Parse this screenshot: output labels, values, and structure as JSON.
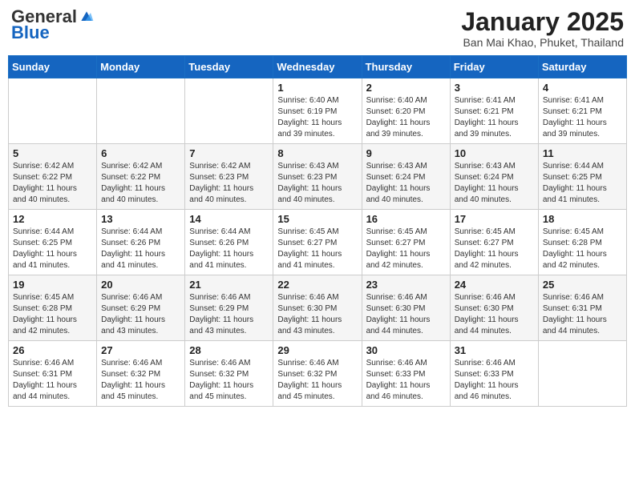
{
  "header": {
    "logo_general": "General",
    "logo_blue": "Blue",
    "month_title": "January 2025",
    "location": "Ban Mai Khao, Phuket, Thailand"
  },
  "days_of_week": [
    "Sunday",
    "Monday",
    "Tuesday",
    "Wednesday",
    "Thursday",
    "Friday",
    "Saturday"
  ],
  "weeks": [
    [
      {
        "day": "",
        "info": ""
      },
      {
        "day": "",
        "info": ""
      },
      {
        "day": "",
        "info": ""
      },
      {
        "day": "1",
        "info": "Sunrise: 6:40 AM\nSunset: 6:19 PM\nDaylight: 11 hours\nand 39 minutes."
      },
      {
        "day": "2",
        "info": "Sunrise: 6:40 AM\nSunset: 6:20 PM\nDaylight: 11 hours\nand 39 minutes."
      },
      {
        "day": "3",
        "info": "Sunrise: 6:41 AM\nSunset: 6:21 PM\nDaylight: 11 hours\nand 39 minutes."
      },
      {
        "day": "4",
        "info": "Sunrise: 6:41 AM\nSunset: 6:21 PM\nDaylight: 11 hours\nand 39 minutes."
      }
    ],
    [
      {
        "day": "5",
        "info": "Sunrise: 6:42 AM\nSunset: 6:22 PM\nDaylight: 11 hours\nand 40 minutes."
      },
      {
        "day": "6",
        "info": "Sunrise: 6:42 AM\nSunset: 6:22 PM\nDaylight: 11 hours\nand 40 minutes."
      },
      {
        "day": "7",
        "info": "Sunrise: 6:42 AM\nSunset: 6:23 PM\nDaylight: 11 hours\nand 40 minutes."
      },
      {
        "day": "8",
        "info": "Sunrise: 6:43 AM\nSunset: 6:23 PM\nDaylight: 11 hours\nand 40 minutes."
      },
      {
        "day": "9",
        "info": "Sunrise: 6:43 AM\nSunset: 6:24 PM\nDaylight: 11 hours\nand 40 minutes."
      },
      {
        "day": "10",
        "info": "Sunrise: 6:43 AM\nSunset: 6:24 PM\nDaylight: 11 hours\nand 40 minutes."
      },
      {
        "day": "11",
        "info": "Sunrise: 6:44 AM\nSunset: 6:25 PM\nDaylight: 11 hours\nand 41 minutes."
      }
    ],
    [
      {
        "day": "12",
        "info": "Sunrise: 6:44 AM\nSunset: 6:25 PM\nDaylight: 11 hours\nand 41 minutes."
      },
      {
        "day": "13",
        "info": "Sunrise: 6:44 AM\nSunset: 6:26 PM\nDaylight: 11 hours\nand 41 minutes."
      },
      {
        "day": "14",
        "info": "Sunrise: 6:44 AM\nSunset: 6:26 PM\nDaylight: 11 hours\nand 41 minutes."
      },
      {
        "day": "15",
        "info": "Sunrise: 6:45 AM\nSunset: 6:27 PM\nDaylight: 11 hours\nand 41 minutes."
      },
      {
        "day": "16",
        "info": "Sunrise: 6:45 AM\nSunset: 6:27 PM\nDaylight: 11 hours\nand 42 minutes."
      },
      {
        "day": "17",
        "info": "Sunrise: 6:45 AM\nSunset: 6:27 PM\nDaylight: 11 hours\nand 42 minutes."
      },
      {
        "day": "18",
        "info": "Sunrise: 6:45 AM\nSunset: 6:28 PM\nDaylight: 11 hours\nand 42 minutes."
      }
    ],
    [
      {
        "day": "19",
        "info": "Sunrise: 6:45 AM\nSunset: 6:28 PM\nDaylight: 11 hours\nand 42 minutes."
      },
      {
        "day": "20",
        "info": "Sunrise: 6:46 AM\nSunset: 6:29 PM\nDaylight: 11 hours\nand 43 minutes."
      },
      {
        "day": "21",
        "info": "Sunrise: 6:46 AM\nSunset: 6:29 PM\nDaylight: 11 hours\nand 43 minutes."
      },
      {
        "day": "22",
        "info": "Sunrise: 6:46 AM\nSunset: 6:30 PM\nDaylight: 11 hours\nand 43 minutes."
      },
      {
        "day": "23",
        "info": "Sunrise: 6:46 AM\nSunset: 6:30 PM\nDaylight: 11 hours\nand 44 minutes."
      },
      {
        "day": "24",
        "info": "Sunrise: 6:46 AM\nSunset: 6:30 PM\nDaylight: 11 hours\nand 44 minutes."
      },
      {
        "day": "25",
        "info": "Sunrise: 6:46 AM\nSunset: 6:31 PM\nDaylight: 11 hours\nand 44 minutes."
      }
    ],
    [
      {
        "day": "26",
        "info": "Sunrise: 6:46 AM\nSunset: 6:31 PM\nDaylight: 11 hours\nand 44 minutes."
      },
      {
        "day": "27",
        "info": "Sunrise: 6:46 AM\nSunset: 6:32 PM\nDaylight: 11 hours\nand 45 minutes."
      },
      {
        "day": "28",
        "info": "Sunrise: 6:46 AM\nSunset: 6:32 PM\nDaylight: 11 hours\nand 45 minutes."
      },
      {
        "day": "29",
        "info": "Sunrise: 6:46 AM\nSunset: 6:32 PM\nDaylight: 11 hours\nand 45 minutes."
      },
      {
        "day": "30",
        "info": "Sunrise: 6:46 AM\nSunset: 6:33 PM\nDaylight: 11 hours\nand 46 minutes."
      },
      {
        "day": "31",
        "info": "Sunrise: 6:46 AM\nSunset: 6:33 PM\nDaylight: 11 hours\nand 46 minutes."
      },
      {
        "day": "",
        "info": ""
      }
    ]
  ]
}
